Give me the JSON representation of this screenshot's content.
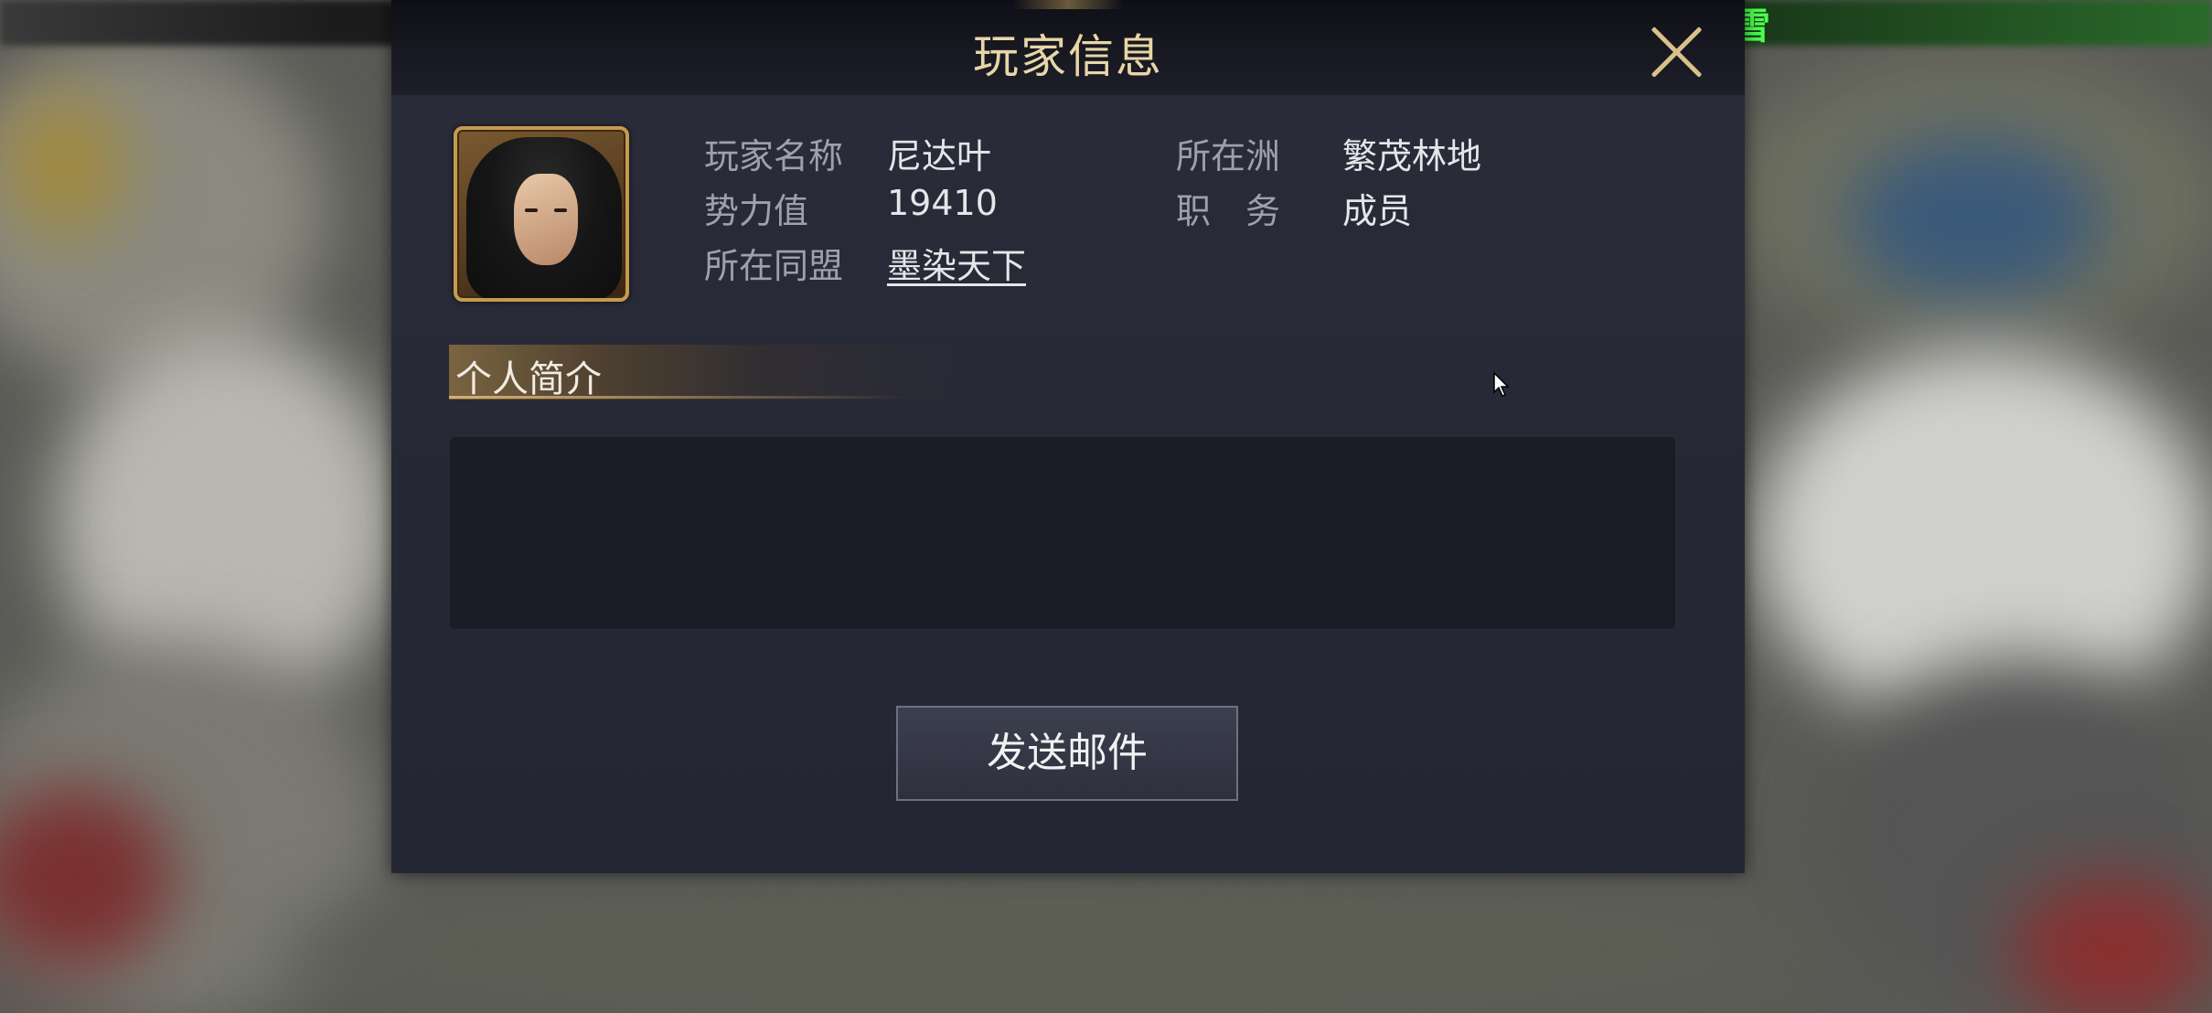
{
  "hud": {
    "weather": "大雪"
  },
  "dialog": {
    "title": "玩家信息",
    "profile": {
      "name_label": "玩家名称",
      "name_value": "尼达叶",
      "power_label": "势力值",
      "power_value": "19410",
      "alliance_label": "所在同盟",
      "alliance_value": "墨染天下",
      "continent_label": "所在洲",
      "continent_value": "繁茂林地",
      "role_label": "职　务",
      "role_value": "成员"
    },
    "bio": {
      "title": "个人简介",
      "text": ""
    },
    "send_mail_label": "发送邮件"
  },
  "colors": {
    "title": "#e8d6a8",
    "gold_frame": "#c79a4e",
    "weather": "#4dff4d",
    "panel": "#262836"
  }
}
